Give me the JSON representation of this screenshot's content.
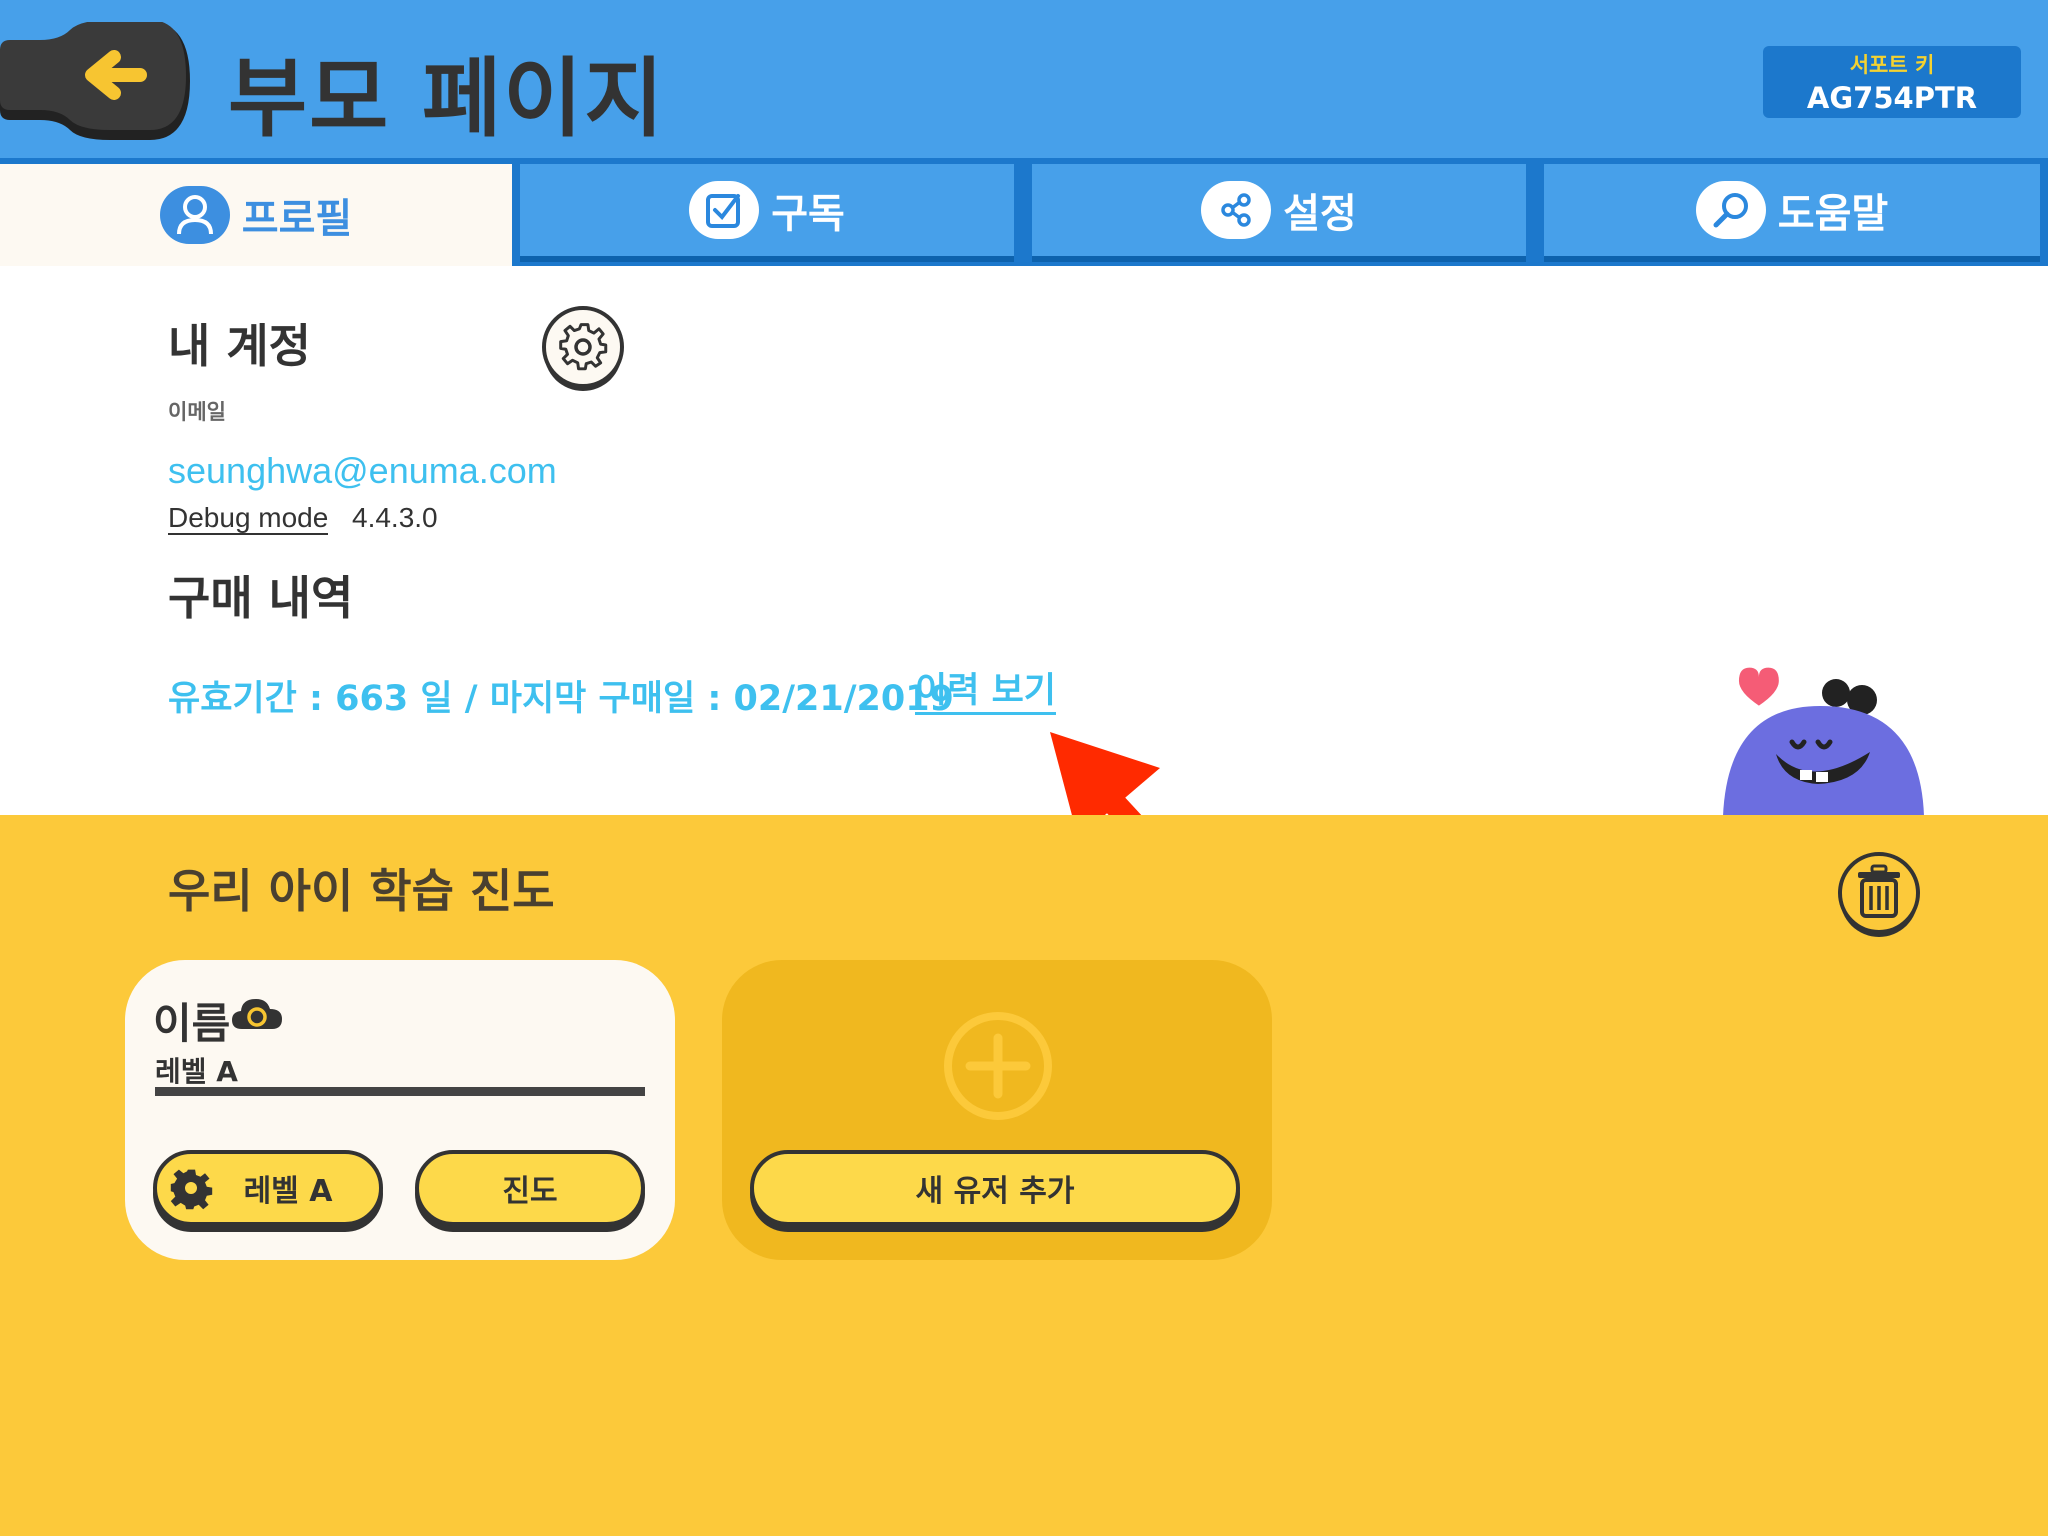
{
  "header": {
    "title": "부모 페이지",
    "support_label": "서포트 키",
    "support_key": "AG754PTR"
  },
  "tabs": [
    {
      "label": "프로필",
      "icon": "person-icon",
      "active": true
    },
    {
      "label": "구독",
      "icon": "checkbox-icon",
      "active": false
    },
    {
      "label": "설정",
      "icon": "settings-sliders-icon",
      "active": false
    },
    {
      "label": "도움말",
      "icon": "magnifier-icon",
      "active": false
    }
  ],
  "account": {
    "title": "내 계정",
    "email_label": "이메일",
    "email": "seunghwa@enuma.com",
    "debug_label": "Debug mode",
    "version": "4.4.3.0"
  },
  "purchase": {
    "title": "구매 내역",
    "validity_text": "유효기간 : 663 일 / 마지막 구매일 : 02/21/2019",
    "history_link": "이력 보기"
  },
  "progress": {
    "title": "우리 아이 학습 진도",
    "users": [
      {
        "name": "이름",
        "level": "레벨 A",
        "level_button": "레벨 A",
        "progress_button": "진도"
      }
    ],
    "add_user_button": "새 유저 추가"
  },
  "colors": {
    "header_blue": "#47a0ea",
    "tab_dark_blue": "#1c78cc",
    "link_cyan": "#3ec0ef",
    "progress_yellow": "#fcc93a",
    "button_yellow": "#fdd94a",
    "annotation_red": "#ff2a00"
  }
}
